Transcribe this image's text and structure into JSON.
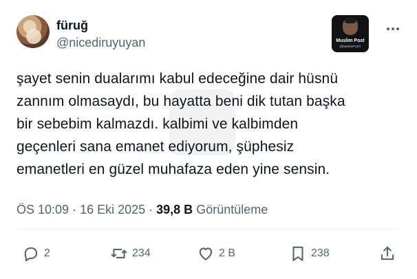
{
  "user": {
    "display_name": "füruğ",
    "handle": "@nicediruyuyan"
  },
  "badge": {
    "title": "Muslim Post",
    "subtitle": "@MuslimPOST"
  },
  "tweet": {
    "lines": [
      "şayet senin dualarımı kabul edeceğine dair hüsnü",
      "zannım olmasaydı, bu hayatta beni dik tutan başka",
      "bir sebebim kalmazdı. kalbimi ve kalbimden",
      "geçenleri sana emanet ediyorum, şüphesiz",
      "emanetleri en güzel muhafaza eden yine sensin."
    ],
    "time": "ÖS 10:09",
    "separator": " · ",
    "date": "16 Eki 2025",
    "views_count": "39,8 B",
    "views_label": "Görüntüleme"
  },
  "actions": {
    "replies": "2",
    "reposts": "234",
    "likes": "2 B",
    "bookmarks": "238"
  },
  "icons": {
    "reply": "reply-icon",
    "repost": "repost-icon",
    "like": "heart-icon",
    "bookmark": "bookmark-icon",
    "share": "share-icon",
    "more": "more-icon"
  },
  "colors": {
    "text": "#0f1419",
    "secondary": "#536471",
    "divider": "#eff3f4",
    "background": "#ffffff"
  }
}
